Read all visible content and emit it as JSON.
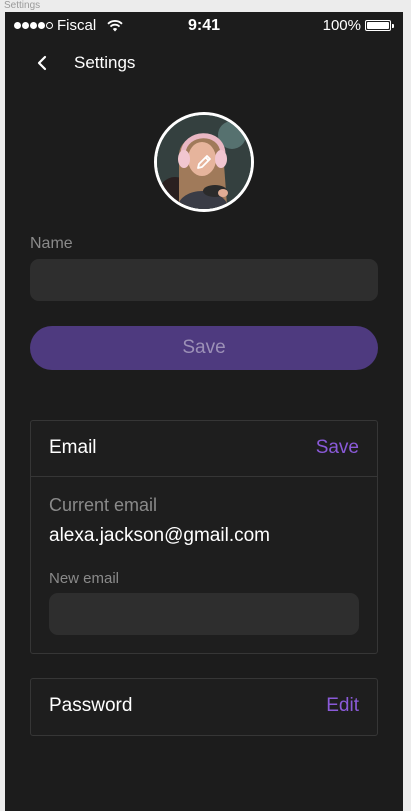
{
  "frame": {
    "label": "Settings"
  },
  "status_bar": {
    "carrier": "Fiscal",
    "time": "9:41",
    "battery": "100%",
    "signal_icon": "signal-dots-icon",
    "wifi_icon": "wifi-icon",
    "battery_icon": "battery-icon"
  },
  "nav": {
    "title": "Settings",
    "back_icon": "chevron-left-icon"
  },
  "profile": {
    "avatar_icon": "avatar-photo",
    "edit_icon": "pencil-icon",
    "name_label": "Name",
    "name_value": "",
    "save_label": "Save"
  },
  "email_section": {
    "title": "Email",
    "action": "Save",
    "current_label": "Current email",
    "current_value": "alexa.jackson@gmail.com",
    "new_label": "New email",
    "new_value": ""
  },
  "password_section": {
    "title": "Password",
    "action": "Edit"
  },
  "colors": {
    "background": "#1c1c1c",
    "surface": "#2e2e2e",
    "accent": "#8a5ad8",
    "button": "#4e3a7f"
  }
}
